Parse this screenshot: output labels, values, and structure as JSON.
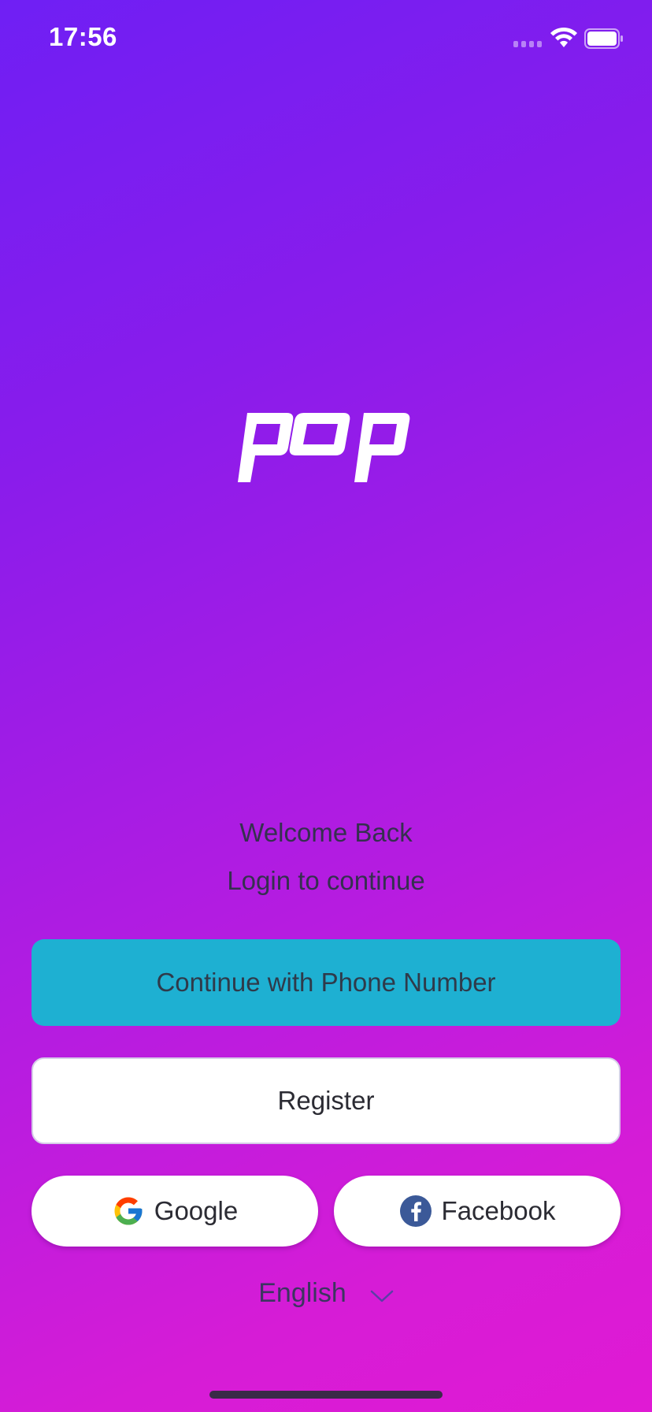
{
  "status_bar": {
    "time": "17:56"
  },
  "brand": {
    "logo_text": "pop",
    "logo_color": "#ffffff"
  },
  "welcome": {
    "title": "Welcome Back",
    "subtitle": "Login to continue"
  },
  "buttons": {
    "phone_label": "Continue with Phone Number",
    "register_label": "Register",
    "google_label": "Google",
    "facebook_label": "Facebook"
  },
  "language": {
    "selected": "English"
  },
  "colors": {
    "gradient_start": "#6f1ff4",
    "gradient_end": "#e01ad4",
    "phone_button": "#1eb0d2",
    "facebook_blue": "#3b5998"
  },
  "icons": {
    "signal": "cellular-signal-icon",
    "wifi": "wifi-icon",
    "battery": "battery-icon",
    "google": "google-g-icon",
    "facebook": "facebook-f-icon",
    "language_caret": "chevron-down-icon"
  }
}
